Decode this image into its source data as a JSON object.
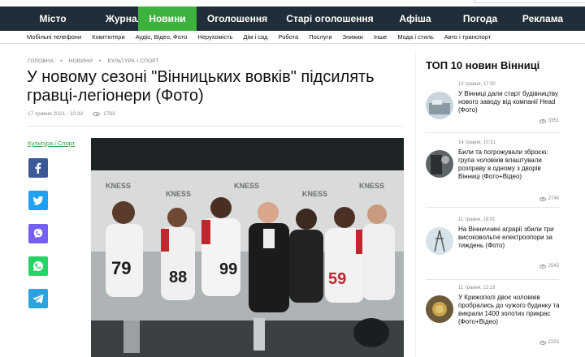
{
  "nav": {
    "items": [
      "Місто",
      "Журнал",
      "Новини",
      "Оголошення",
      "Старі оголошення",
      "Афіша",
      "Погода",
      "Реклама"
    ],
    "active": "Новини",
    "active_color": "#3db23d",
    "bar_color": "#1f2e38"
  },
  "subnav": {
    "items": [
      "Мобільні телефони",
      "Комп'ютери",
      "Аудіо, Відео, Фото",
      "Нерухомість",
      "Дім і сад",
      "Робота",
      "Послуги",
      "Знижки",
      "Інше",
      "Мода і стиль",
      "Авто і транспорт"
    ]
  },
  "breadcrumb": [
    "ГОЛОВНА",
    "•",
    "НОВИНИ",
    "•",
    "КУЛЬТУРА І СПОРТ"
  ],
  "article": {
    "title": "У новому сезоні \"Вінницьких вовків\" підсилять гравці-легіонери (Фото)",
    "date": "17 травня 2021 - 10:32",
    "views": "1783",
    "category": "Культура і Спорт"
  },
  "share": {
    "icons": [
      "facebook-icon",
      "twitter-icon",
      "viber-icon",
      "whatsapp-icon",
      "telegram-icon"
    ]
  },
  "photo": {
    "jersey_numbers": [
      "79",
      "88",
      "99",
      "59"
    ],
    "banner_text": "KNESS"
  },
  "sidebar": {
    "title": "ТОП 10 новин Вінниці",
    "news": [
      {
        "date": "12 травня, 17:50",
        "text": "У Вінниці дали старт будівництву нового заводу від компанії Head (Фото)",
        "views": "3351"
      },
      {
        "date": "14 травня, 10:31",
        "text": "Били та погрожували зброєю: група чоловіків влаштували розправу в одному з дворів Вінниці (Фото+Відео)",
        "views": "2746"
      },
      {
        "date": "11 травня, 18:01",
        "text": "На Вінниччині аграрії збили три високовольтні електроопори за тиждень (Фото)",
        "views": "2543"
      },
      {
        "date": "11 травня, 12:19",
        "text": "У Крижополі двоє чоловіків пробрались до чужого будинку та викрали 1400 золотих прикрас (Фото+Відео)",
        "views": "2253"
      }
    ]
  }
}
